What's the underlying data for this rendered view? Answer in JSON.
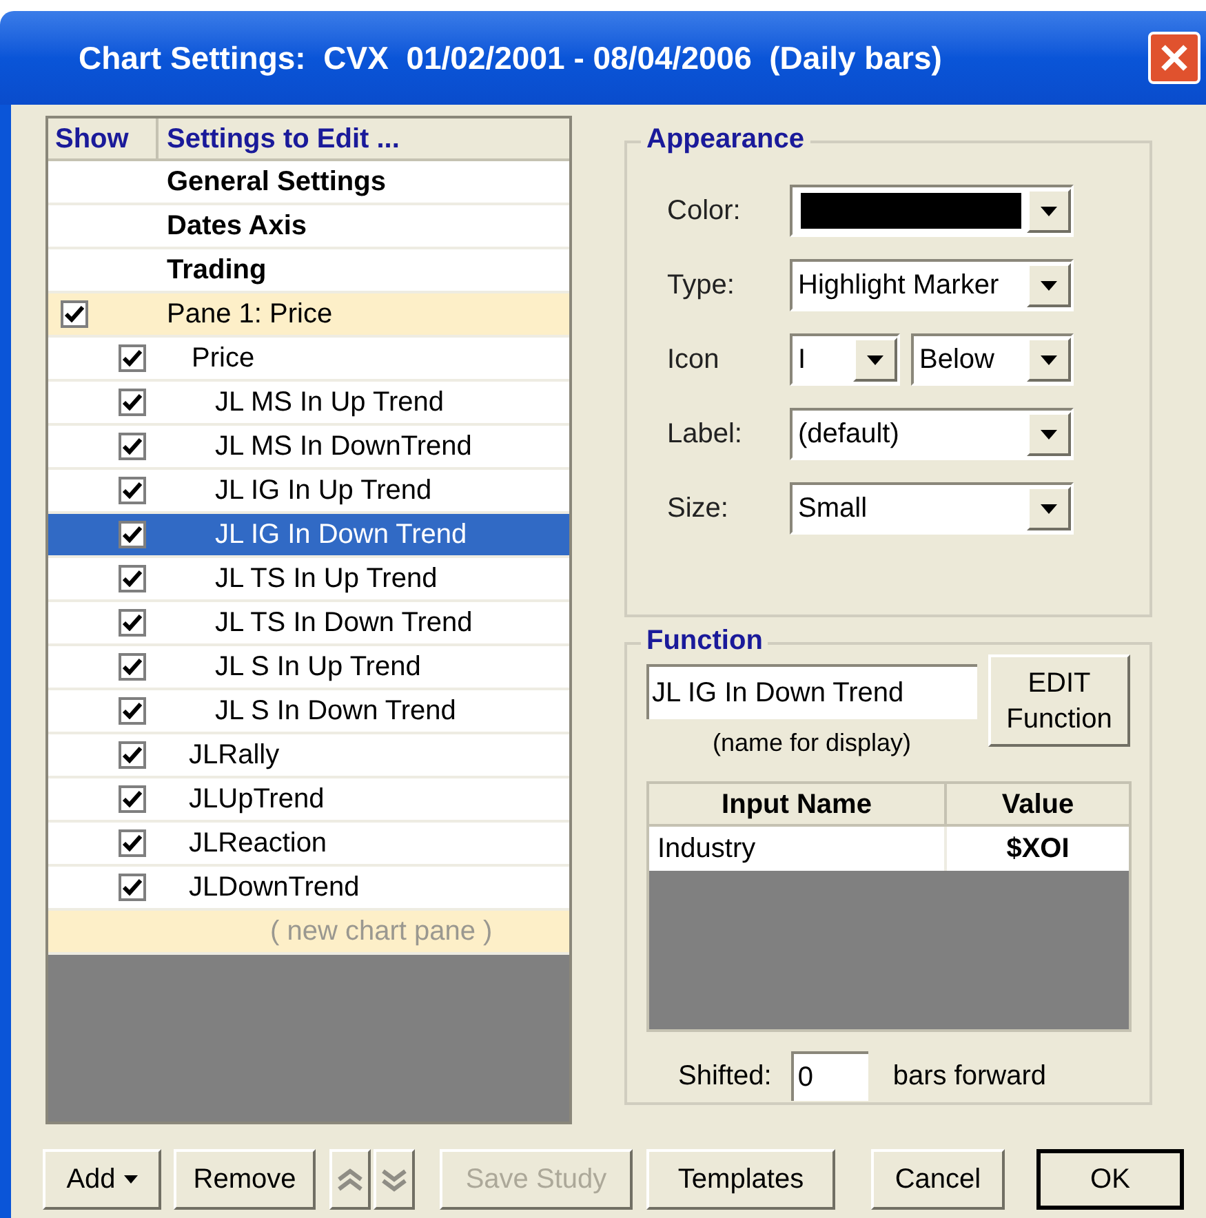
{
  "window": {
    "title": "Chart Settings:  CVX  01/02/2001 - 08/04/2006  (Daily bars)"
  },
  "settings_list": {
    "columns": [
      "Show",
      "Settings to Edit ..."
    ],
    "items": [
      {
        "kind": "section",
        "label": "General Settings",
        "selected": false
      },
      {
        "kind": "section",
        "label": "Dates Axis",
        "selected": false
      },
      {
        "kind": "section",
        "label": "Trading",
        "selected": false
      },
      {
        "kind": "pane",
        "label": "Pane 1:  Price",
        "checked": true,
        "selected": false,
        "children": [
          {
            "kind": "study",
            "label": "Price",
            "checked": true,
            "selected": false,
            "children": [
              {
                "kind": "study",
                "label": "JL MS In Up Trend",
                "checked": true,
                "selected": false
              },
              {
                "kind": "study",
                "label": "JL MS In DownTrend",
                "checked": true,
                "selected": false
              },
              {
                "kind": "study",
                "label": "JL IG In Up Trend",
                "checked": true,
                "selected": false
              },
              {
                "kind": "study",
                "label": "JL IG In Down Trend",
                "checked": true,
                "selected": true
              },
              {
                "kind": "study",
                "label": "JL TS In Up Trend",
                "checked": true,
                "selected": false
              },
              {
                "kind": "study",
                "label": "JL TS In Down Trend",
                "checked": true,
                "selected": false
              },
              {
                "kind": "study",
                "label": "JL S In Up Trend",
                "checked": true,
                "selected": false
              },
              {
                "kind": "study",
                "label": "JL S In Down Trend",
                "checked": true,
                "selected": false
              }
            ]
          },
          {
            "kind": "study",
            "label": "JLRally",
            "checked": true,
            "selected": false
          },
          {
            "kind": "study",
            "label": "JLUpTrend",
            "checked": true,
            "selected": false
          },
          {
            "kind": "study",
            "label": "JLReaction",
            "checked": true,
            "selected": false
          },
          {
            "kind": "study",
            "label": "JLDownTrend",
            "checked": true,
            "selected": false
          }
        ]
      },
      {
        "kind": "placeholder",
        "label": "( new chart pane )",
        "selected": false
      }
    ]
  },
  "appearance": {
    "title": "Appearance",
    "fields": [
      {
        "kind": "color",
        "label": "Color:",
        "color": "#000000"
      },
      {
        "kind": "dropdown",
        "label": "Type:",
        "value": "Highlight Marker"
      },
      {
        "kind": "dropdown_pair",
        "label": "Icon",
        "values": [
          "I",
          "Below"
        ]
      },
      {
        "kind": "dropdown",
        "label": "Label:",
        "value": "(default)"
      },
      {
        "kind": "dropdown",
        "label": "Size:",
        "value": "Small"
      }
    ]
  },
  "function": {
    "title": "Function",
    "name_value": "JL IG In Down Trend",
    "name_caption": "(name for display)",
    "edit_button": "EDIT Function",
    "inputs": {
      "columns": [
        "Input Name",
        "Value"
      ],
      "rows": [
        [
          "Industry",
          "$XOI"
        ]
      ]
    },
    "shift": {
      "label": "Shifted:",
      "value": "0",
      "suffix": "bars forward"
    }
  },
  "buttons": [
    {
      "kind": "menu",
      "label": "Add",
      "disabled": false
    },
    {
      "kind": "plain",
      "label": "Remove",
      "disabled": false
    },
    {
      "kind": "move_up",
      "disabled": true
    },
    {
      "kind": "move_down",
      "disabled": true
    },
    {
      "kind": "plain",
      "label": "Save Study",
      "disabled": true
    },
    {
      "kind": "plain",
      "label": "Templates",
      "disabled": false
    },
    {
      "kind": "plain",
      "label": "Cancel",
      "disabled": false
    },
    {
      "kind": "default",
      "label": "OK",
      "disabled": false
    }
  ]
}
